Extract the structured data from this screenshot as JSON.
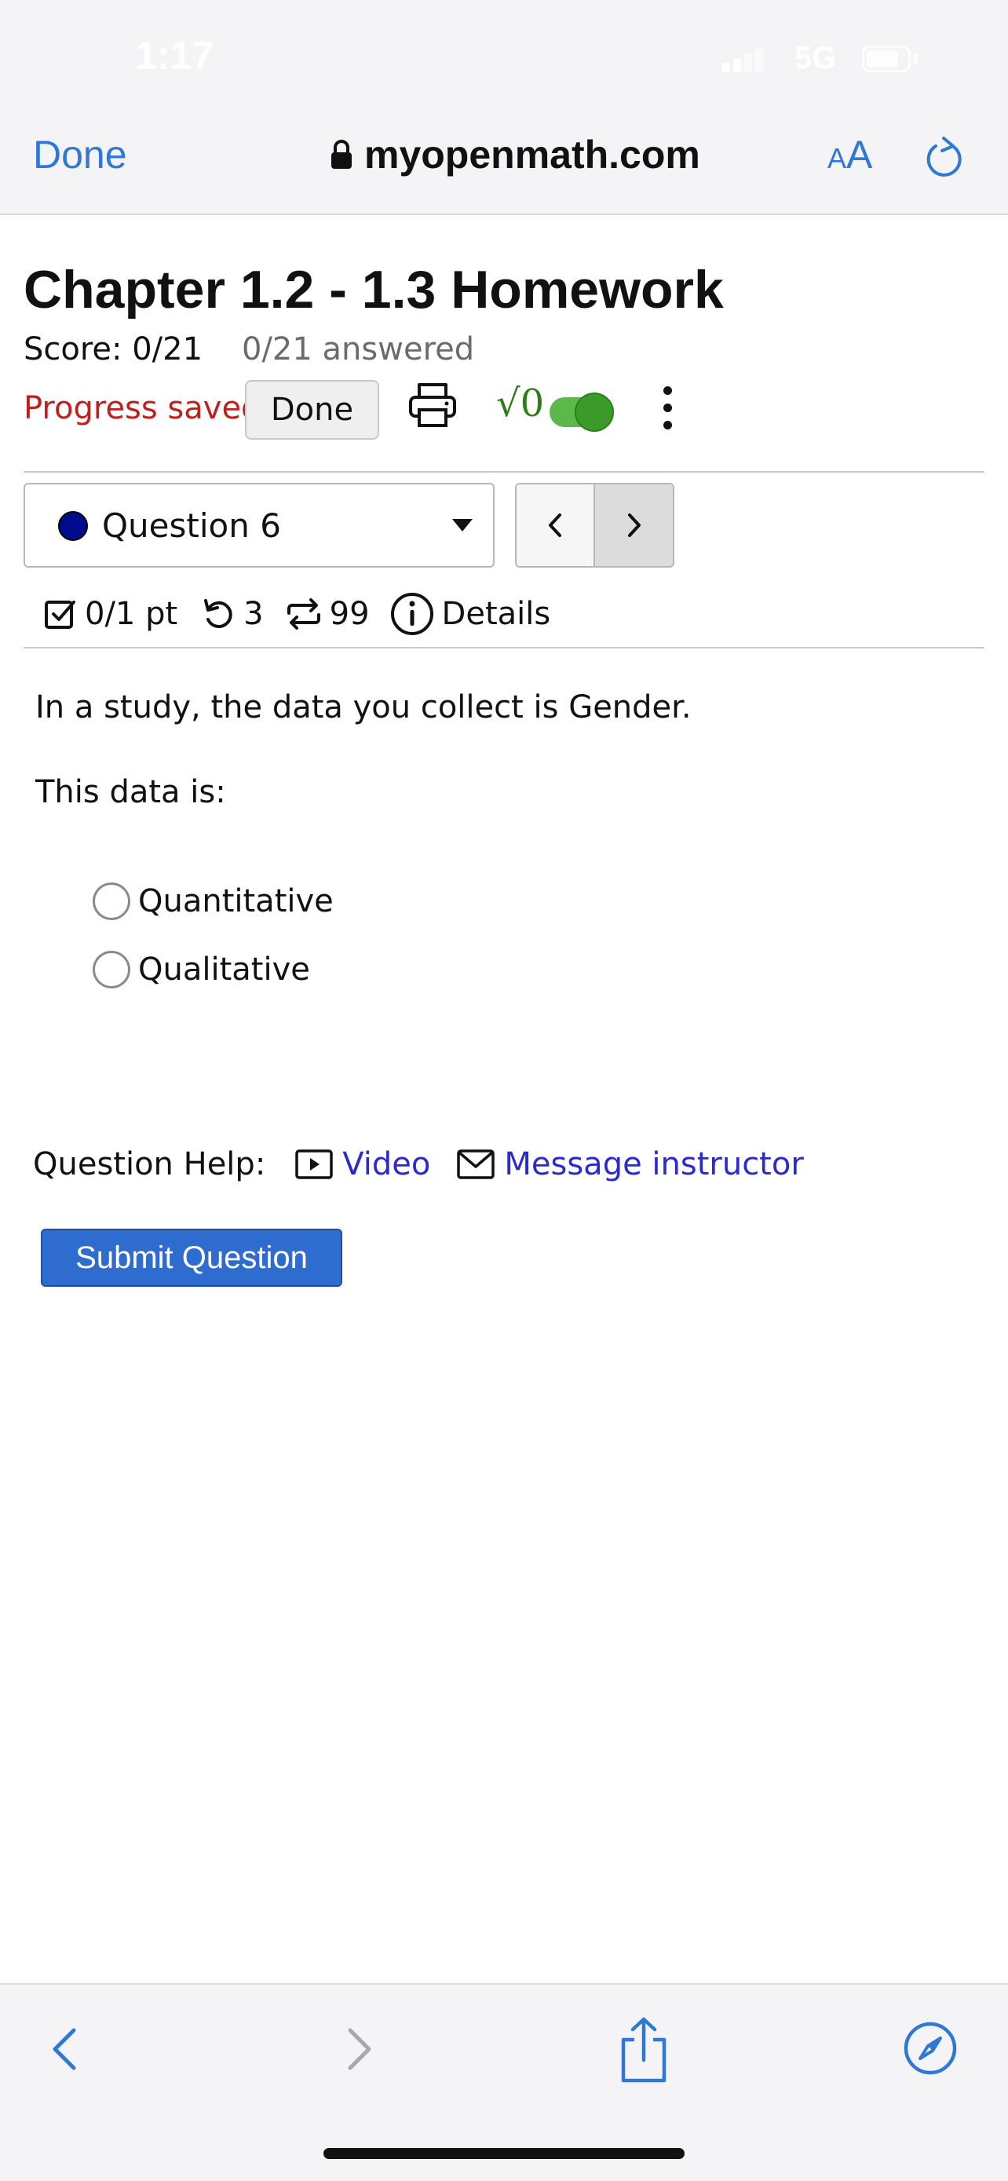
{
  "status_bar": {
    "time": "1:17",
    "network": "5G"
  },
  "browser": {
    "done_label": "Done",
    "url": "myopenmath.com",
    "text_size_small": "A",
    "text_size_large": "A"
  },
  "page": {
    "title": "Chapter 1.2 - 1.3 Homework",
    "score": "Score: 0/21",
    "answered": "0/21 answered",
    "progress_status": "Progress saved",
    "done_button": "Done",
    "math_symbol": "√0",
    "math_toggle_on": true
  },
  "question_nav": {
    "selected": "Question 6",
    "prev_label": "<",
    "next_label": ">"
  },
  "meta": {
    "points": "0/1 pt",
    "retries": "3",
    "attempts": "99",
    "details": "Details"
  },
  "question": {
    "text": "In a study, the data you collect is Gender.",
    "prompt": "This data is:",
    "options": [
      "Quantitative",
      "Qualitative"
    ]
  },
  "help": {
    "label": "Question Help:",
    "video": "Video",
    "message": "Message instructor"
  },
  "submit_label": "Submit Question",
  "colors": {
    "ios_blue": "#2f78d8",
    "progress_red": "#c0201c",
    "link_blue": "#2a2ad0",
    "submit_blue": "#2f6cd0",
    "toggle_green": "#5cb84a"
  }
}
